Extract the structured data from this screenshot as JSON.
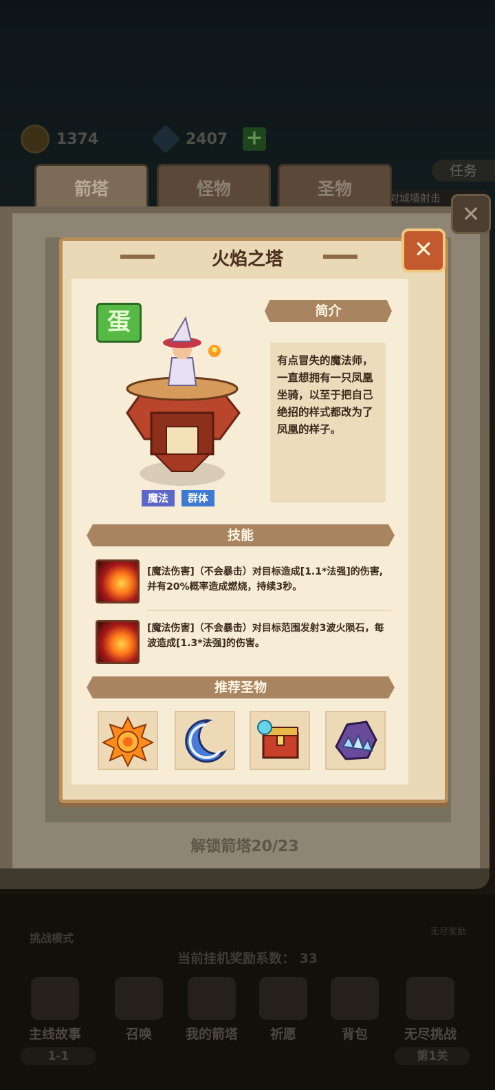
{
  "resources": {
    "coins": "1374",
    "gems": "2407",
    "plus": "+"
  },
  "task_label": "任务",
  "hint_text": "对城墙射击",
  "book_tabs": [
    "箭塔",
    "怪物",
    "圣物"
  ],
  "book_close": "✕",
  "card": {
    "title": "火焰之塔",
    "close": "✕",
    "rarity": "蛋",
    "tags": [
      "魔法",
      "群体"
    ],
    "intro_header": "简介",
    "intro_text": "有点冒失的魔法师，一直想拥有一只凤凰坐骑，以至于把自己绝招的样式都改为了凤凰的样子。",
    "skills_header": "技能",
    "skills": [
      {
        "icon": "fireball-icon",
        "text": "[魔法伤害]（不会暴击）对目标造成[1.1*法强]的伤害,并有20%概率造成燃烧，持续3秒。"
      },
      {
        "icon": "phoenix-flame-icon",
        "text": "[魔法伤害]（不会暴击）对目标范围发射3波火陨石，每波造成[1.3*法强]的伤害。"
      }
    ],
    "relics_header": "推荐圣物",
    "relics": [
      "sun-relic-icon",
      "moon-relic-icon",
      "treasure-chest-relic-icon",
      "crystal-claw-relic-icon"
    ]
  },
  "unlock_text": "解锁箭塔20/23",
  "bottom": {
    "mode": "挑战模式",
    "endless_reward": "无尽奖励",
    "coefficient": "当前挂机奖励系数： 33",
    "nav": [
      "主线故事",
      "召唤",
      "我的箭塔",
      "祈愿",
      "背包",
      "无尽挑战"
    ],
    "stage": "1-1",
    "endless_stage": "第1关"
  }
}
